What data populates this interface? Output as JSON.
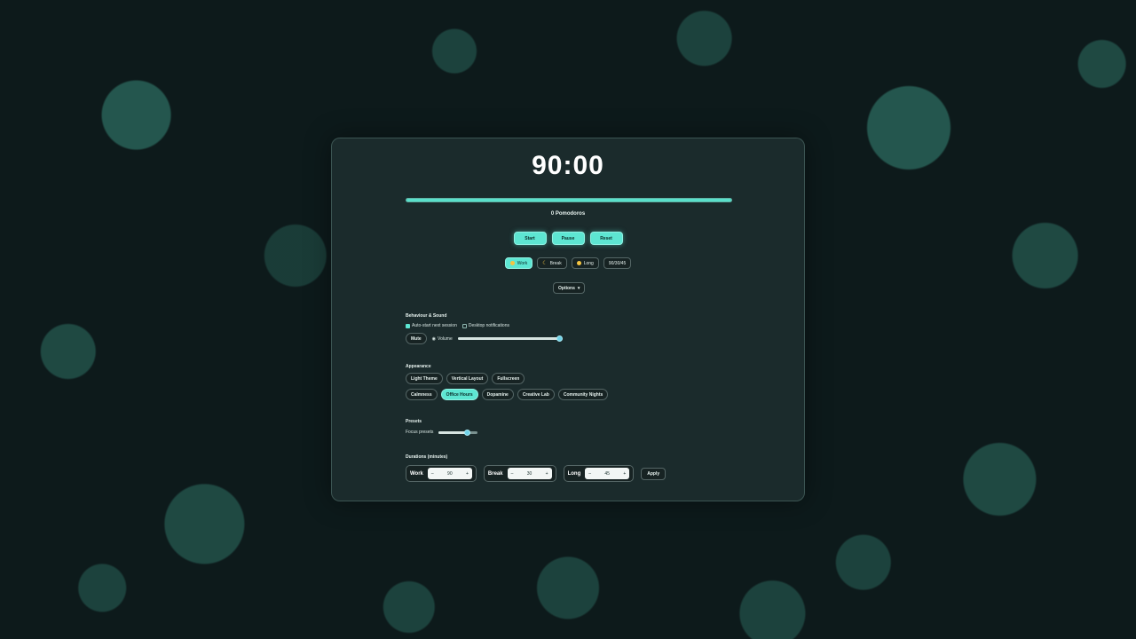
{
  "timer": {
    "display": "90:00",
    "progress": 1.0
  },
  "pomodoros": {
    "text": "0 Pomodoros"
  },
  "controls": {
    "start": "Start",
    "pause": "Pause",
    "reset": "Reset"
  },
  "modes": {
    "work": "Work",
    "break": "Break",
    "long": "Long",
    "preset": "90/30/45",
    "active": "work"
  },
  "options": {
    "label": "Options"
  },
  "behaviour": {
    "title": "Behaviour & Sound",
    "auto_start": {
      "label": "Auto-start next session",
      "checked": true
    },
    "desktop_notifications": {
      "label": "Desktop notifications",
      "checked": false
    },
    "mute": "Mute",
    "volume_label": "Volume",
    "volume": 1.0
  },
  "appearance": {
    "title": "Appearance",
    "toggles": [
      "Light Theme",
      "Vertical Layout",
      "Fullscreen"
    ],
    "themes": [
      "Calmness",
      "Office Hours",
      "Dopamine",
      "Creative Lab",
      "Community Nights"
    ],
    "active_theme": "Office Hours"
  },
  "presets": {
    "title": "Presets",
    "label": "Focus presets",
    "value": 0.75
  },
  "durations": {
    "title": "Durations (minutes)",
    "work_label": "Work",
    "work_value": "90",
    "break_label": "Break",
    "break_value": "30",
    "long_label": "Long",
    "long_value": "45",
    "minus": "–",
    "plus": "+",
    "apply": "Apply"
  },
  "colors": {
    "accent": "#5de6d2",
    "background": "#0d1a1b"
  }
}
